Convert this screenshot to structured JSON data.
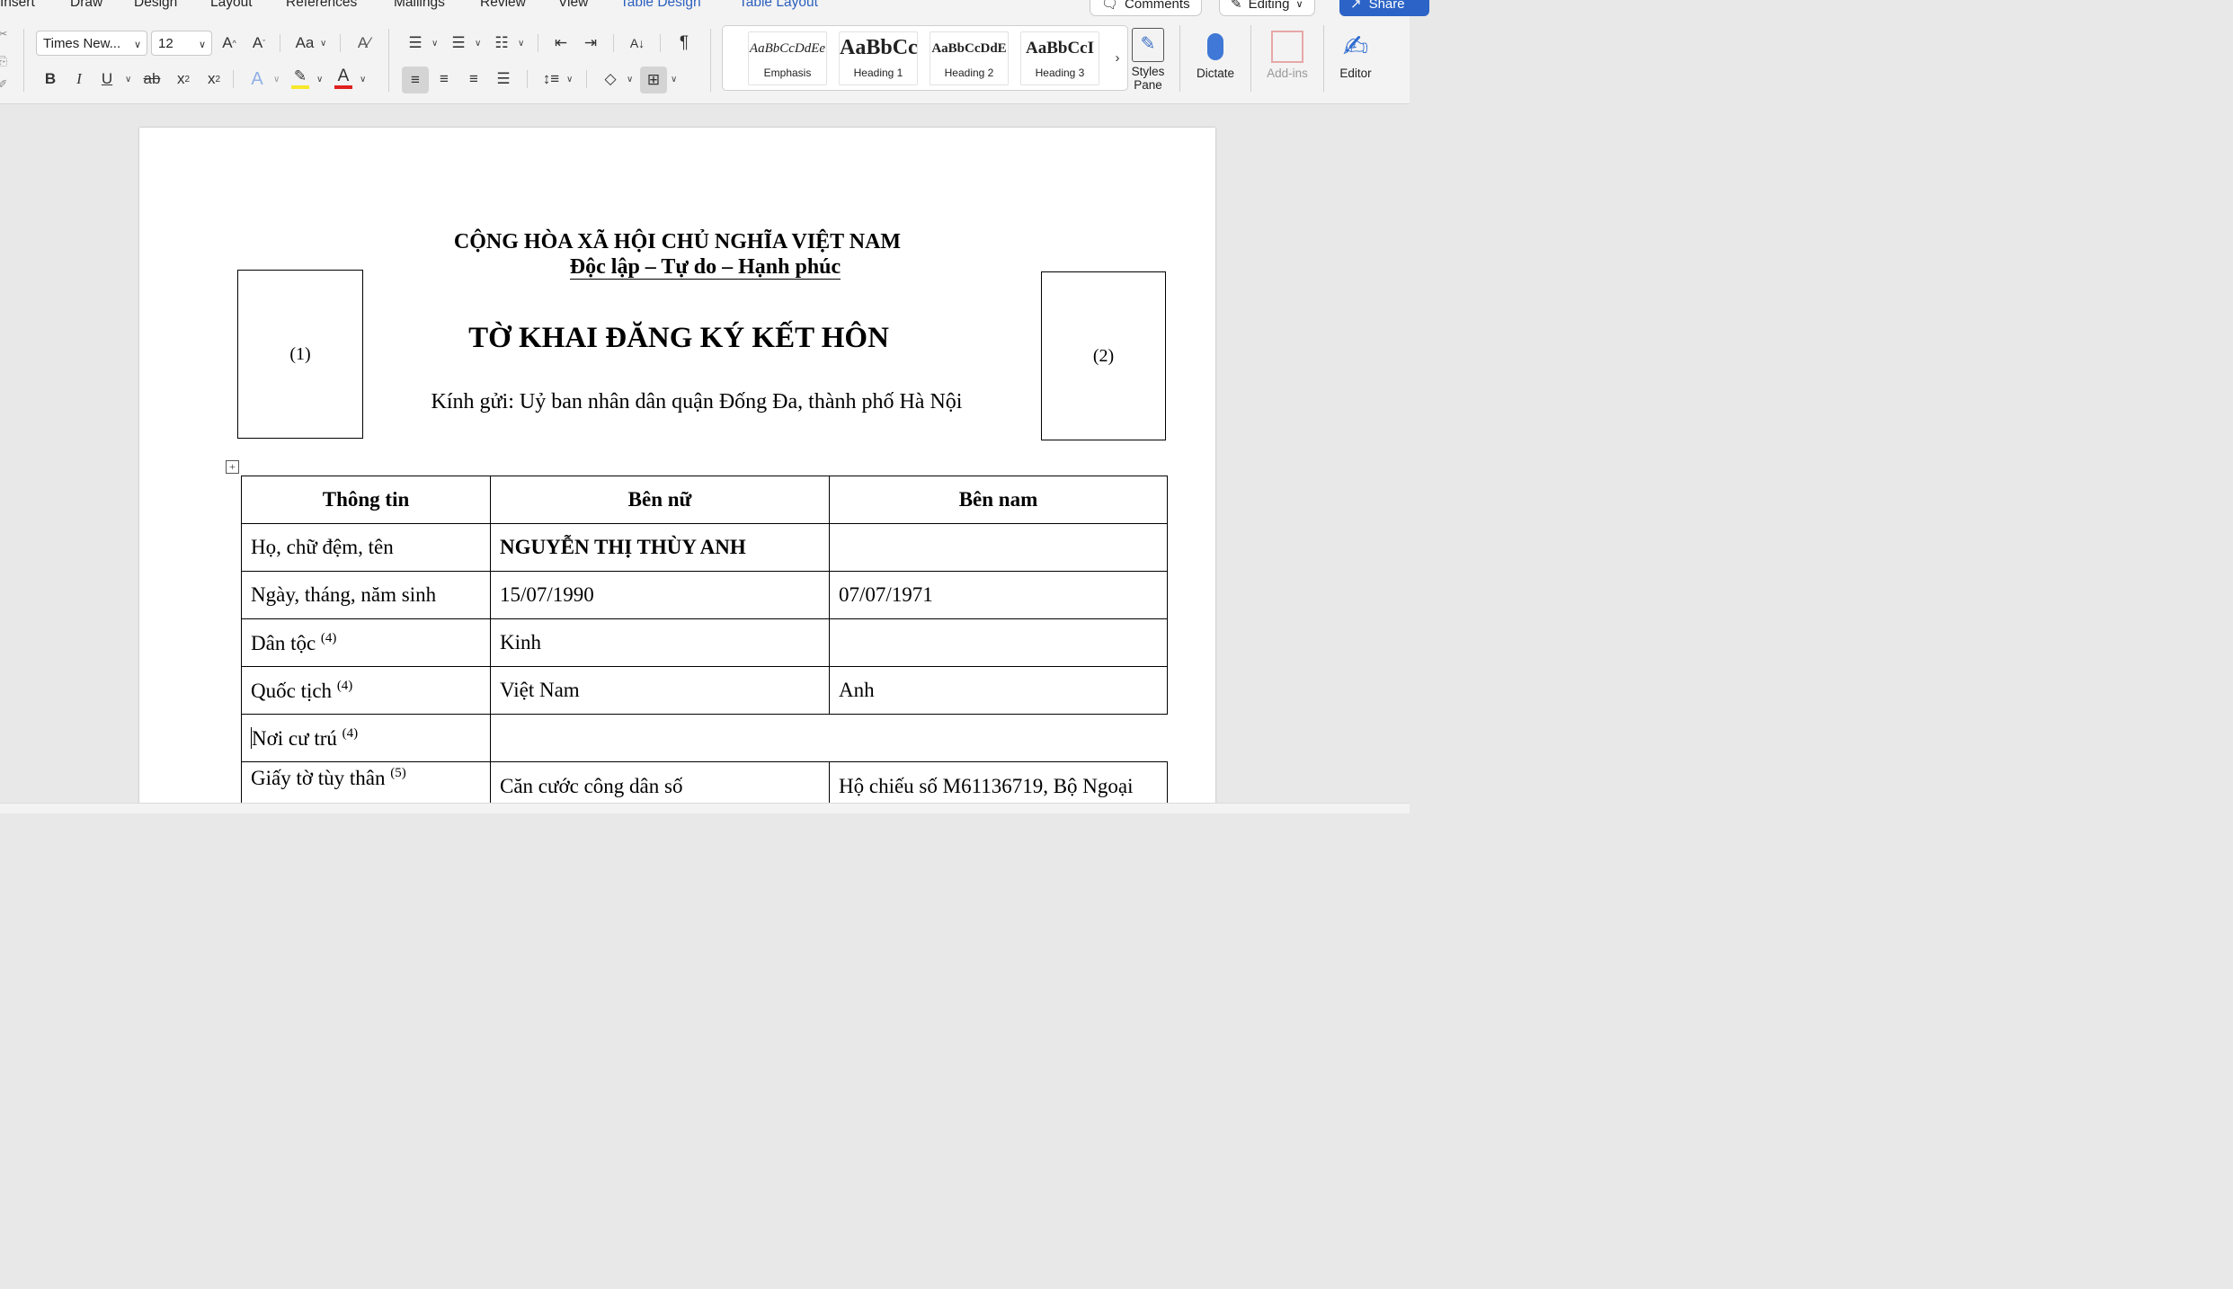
{
  "ribbon": {
    "tabs": [
      "Insert",
      "Draw",
      "Design",
      "Layout",
      "References",
      "Mailings",
      "Review",
      "View",
      "Table Design",
      "Table Layout"
    ],
    "comments_label": "Comments",
    "editing_label": "Editing",
    "share_label": "Share",
    "font_name": "Times New...",
    "font_size": "12",
    "change_case_label": "Aa",
    "styles": [
      {
        "sample": "AaBbCcDdEe",
        "label": "Emphasis"
      },
      {
        "sample": "AaBbCc",
        "label": "Heading 1"
      },
      {
        "sample": "AaBbCcDdE",
        "label": "Heading 2"
      },
      {
        "sample": "AaBbCcI",
        "label": "Heading 3"
      }
    ],
    "styles_pane_label": "Styles Pane",
    "dictate_label": "Dictate",
    "addins_label": "Add-ins",
    "editor_label": "Editor",
    "colors": {
      "highlight": "#f7e82b",
      "font_color": "#e02020",
      "accent": "#2b63c6"
    }
  },
  "document": {
    "national_title": "CỘNG HÒA XÃ HỘI CHỦ NGHĨA VIỆT NAM",
    "motto": "Độc lập – Tự do – Hạnh phúc",
    "form_title": "TỜ KHAI ĐĂNG KÝ KẾT HÔN",
    "addressee": "Kính gửi: Uỷ ban nhân dân quận Đống Đa, thành phố Hà Nội",
    "photo_left": "(1)",
    "photo_right": "(2)",
    "table": {
      "headers": [
        "Thông tin",
        "Bên nữ",
        "Bên nam"
      ],
      "rows": [
        {
          "label": "Họ, chữ đệm, tên",
          "note": "",
          "female": "NGUYỄN THỊ THÙY ANH",
          "male": ""
        },
        {
          "label": "Ngày, tháng, năm sinh",
          "note": "",
          "female": "15/07/1990",
          "male": "07/07/1971"
        },
        {
          "label": "Dân tộc",
          "note": "(4)",
          "female": "Kinh",
          "male": ""
        },
        {
          "label": "Quốc tịch",
          "note": "(4)",
          "female": "Việt Nam",
          "male": "Anh"
        },
        {
          "label": "Nơi cư trú",
          "note": "(4)",
          "female": "",
          "male": ""
        },
        {
          "label": "Giấy tờ tùy thân",
          "note": "(5)",
          "female": "Căn cước công dân số",
          "male": "Hộ chiếu số M61136719, Bộ Ngoại"
        }
      ]
    }
  }
}
